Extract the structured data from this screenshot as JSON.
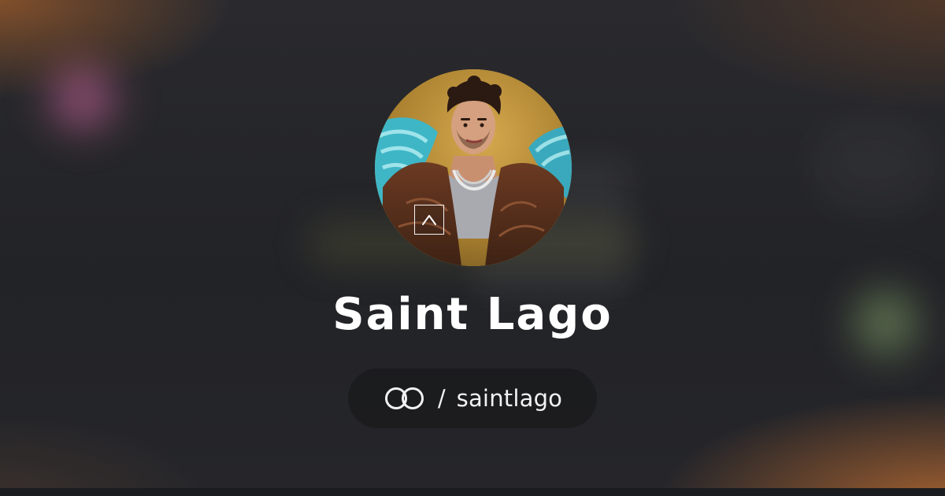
{
  "profile": {
    "display_name": "Saint Lago",
    "avatar_icon": "profile-photo",
    "badge_icon": "caret-up-icon"
  },
  "handle": {
    "logo_icon": "linked-rings-logo",
    "separator": "/",
    "username": "saintlago"
  },
  "colors": {
    "background": "#24252a",
    "accent_warm": "#d67832",
    "text": "#ffffff",
    "pill": "#161618"
  }
}
